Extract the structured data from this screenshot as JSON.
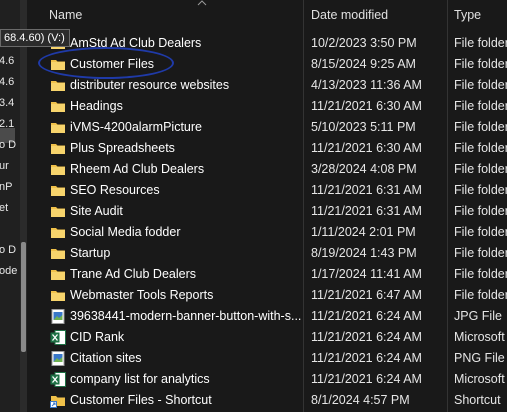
{
  "navigation": {
    "drive_tooltip": "68.4.60) (V:)",
    "fragments": [
      "4.6",
      "4.6",
      "3.4",
      "2.1",
      "o D",
      "ur",
      "nP",
      "et",
      "o D",
      "ode"
    ]
  },
  "columns": {
    "name": "Name",
    "date_modified": "Date modified",
    "type": "Type"
  },
  "files": [
    {
      "name": "AmStd Ad Club Dealers",
      "date": "10/2/2023 3:50 PM",
      "type": "File folder",
      "icon": "folder-icon"
    },
    {
      "name": "Customer Files",
      "date": "8/15/2024 9:25 AM",
      "type": "File folder",
      "icon": "folder-icon"
    },
    {
      "name": "distributer resource websites",
      "date": "4/13/2023 11:36 AM",
      "type": "File folder",
      "icon": "folder-icon"
    },
    {
      "name": "Headings",
      "date": "11/21/2021 6:30 AM",
      "type": "File folder",
      "icon": "folder-icon"
    },
    {
      "name": "iVMS-4200alarmPicture",
      "date": "5/10/2023 5:11 PM",
      "type": "File folder",
      "icon": "folder-icon"
    },
    {
      "name": "Plus Spreadsheets",
      "date": "11/21/2021 6:30 AM",
      "type": "File folder",
      "icon": "folder-icon"
    },
    {
      "name": "Rheem Ad Club Dealers",
      "date": "3/28/2024 4:08 PM",
      "type": "File folder",
      "icon": "folder-icon"
    },
    {
      "name": "SEO Resources",
      "date": "11/21/2021 6:31 AM",
      "type": "File folder",
      "icon": "folder-icon"
    },
    {
      "name": "Site Audit",
      "date": "11/21/2021 6:31 AM",
      "type": "File folder",
      "icon": "folder-icon"
    },
    {
      "name": "Social Media fodder",
      "date": "1/11/2024 2:01 PM",
      "type": "File folder",
      "icon": "folder-icon"
    },
    {
      "name": "Startup",
      "date": "8/19/2024 1:43 PM",
      "type": "File folder",
      "icon": "folder-icon"
    },
    {
      "name": "Trane Ad Club Dealers",
      "date": "1/17/2024 11:41 AM",
      "type": "File folder",
      "icon": "folder-icon"
    },
    {
      "name": "Webmaster Tools Reports",
      "date": "11/21/2021 6:47 AM",
      "type": "File folder",
      "icon": "folder-icon"
    },
    {
      "name": "39638441-modern-banner-button-with-s...",
      "date": "11/21/2021 6:24 AM",
      "type": "JPG File",
      "icon": "image-file-icon"
    },
    {
      "name": "CID Rank",
      "date": "11/21/2021 6:24 AM",
      "type": "Microsoft",
      "icon": "excel-file-icon"
    },
    {
      "name": "Citation sites",
      "date": "11/21/2021 6:24 AM",
      "type": "PNG File",
      "icon": "image-file-icon"
    },
    {
      "name": "company list for analytics",
      "date": "11/21/2021 6:24 AM",
      "type": "Microsoft",
      "icon": "excel-file-icon"
    },
    {
      "name": "Customer Files - Shortcut",
      "date": "8/1/2024 4:57 PM",
      "type": "Shortcut",
      "icon": "shortcut-icon"
    }
  ],
  "colors": {
    "background": "#191919",
    "folder": "#f0c14a",
    "highlight_ring": "#1f3aa8",
    "excel": "#1e7145"
  }
}
